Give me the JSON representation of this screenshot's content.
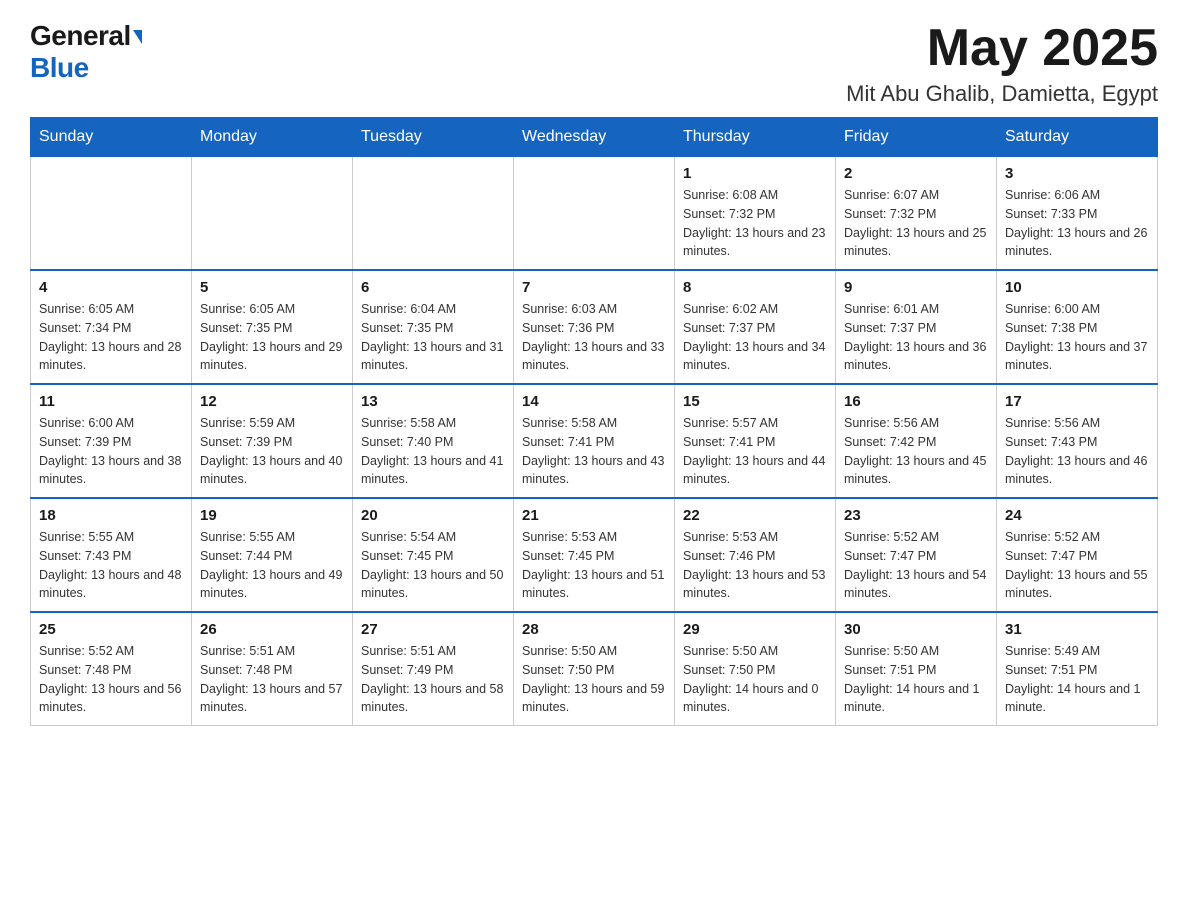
{
  "header": {
    "logo_general": "General",
    "logo_blue": "Blue",
    "month_title": "May 2025",
    "location": "Mit Abu Ghalib, Damietta, Egypt"
  },
  "weekdays": [
    "Sunday",
    "Monday",
    "Tuesday",
    "Wednesday",
    "Thursday",
    "Friday",
    "Saturday"
  ],
  "weeks": [
    [
      {
        "day": "",
        "sunrise": "",
        "sunset": "",
        "daylight": ""
      },
      {
        "day": "",
        "sunrise": "",
        "sunset": "",
        "daylight": ""
      },
      {
        "day": "",
        "sunrise": "",
        "sunset": "",
        "daylight": ""
      },
      {
        "day": "",
        "sunrise": "",
        "sunset": "",
        "daylight": ""
      },
      {
        "day": "1",
        "sunrise": "Sunrise: 6:08 AM",
        "sunset": "Sunset: 7:32 PM",
        "daylight": "Daylight: 13 hours and 23 minutes."
      },
      {
        "day": "2",
        "sunrise": "Sunrise: 6:07 AM",
        "sunset": "Sunset: 7:32 PM",
        "daylight": "Daylight: 13 hours and 25 minutes."
      },
      {
        "day": "3",
        "sunrise": "Sunrise: 6:06 AM",
        "sunset": "Sunset: 7:33 PM",
        "daylight": "Daylight: 13 hours and 26 minutes."
      }
    ],
    [
      {
        "day": "4",
        "sunrise": "Sunrise: 6:05 AM",
        "sunset": "Sunset: 7:34 PM",
        "daylight": "Daylight: 13 hours and 28 minutes."
      },
      {
        "day": "5",
        "sunrise": "Sunrise: 6:05 AM",
        "sunset": "Sunset: 7:35 PM",
        "daylight": "Daylight: 13 hours and 29 minutes."
      },
      {
        "day": "6",
        "sunrise": "Sunrise: 6:04 AM",
        "sunset": "Sunset: 7:35 PM",
        "daylight": "Daylight: 13 hours and 31 minutes."
      },
      {
        "day": "7",
        "sunrise": "Sunrise: 6:03 AM",
        "sunset": "Sunset: 7:36 PM",
        "daylight": "Daylight: 13 hours and 33 minutes."
      },
      {
        "day": "8",
        "sunrise": "Sunrise: 6:02 AM",
        "sunset": "Sunset: 7:37 PM",
        "daylight": "Daylight: 13 hours and 34 minutes."
      },
      {
        "day": "9",
        "sunrise": "Sunrise: 6:01 AM",
        "sunset": "Sunset: 7:37 PM",
        "daylight": "Daylight: 13 hours and 36 minutes."
      },
      {
        "day": "10",
        "sunrise": "Sunrise: 6:00 AM",
        "sunset": "Sunset: 7:38 PM",
        "daylight": "Daylight: 13 hours and 37 minutes."
      }
    ],
    [
      {
        "day": "11",
        "sunrise": "Sunrise: 6:00 AM",
        "sunset": "Sunset: 7:39 PM",
        "daylight": "Daylight: 13 hours and 38 minutes."
      },
      {
        "day": "12",
        "sunrise": "Sunrise: 5:59 AM",
        "sunset": "Sunset: 7:39 PM",
        "daylight": "Daylight: 13 hours and 40 minutes."
      },
      {
        "day": "13",
        "sunrise": "Sunrise: 5:58 AM",
        "sunset": "Sunset: 7:40 PM",
        "daylight": "Daylight: 13 hours and 41 minutes."
      },
      {
        "day": "14",
        "sunrise": "Sunrise: 5:58 AM",
        "sunset": "Sunset: 7:41 PM",
        "daylight": "Daylight: 13 hours and 43 minutes."
      },
      {
        "day": "15",
        "sunrise": "Sunrise: 5:57 AM",
        "sunset": "Sunset: 7:41 PM",
        "daylight": "Daylight: 13 hours and 44 minutes."
      },
      {
        "day": "16",
        "sunrise": "Sunrise: 5:56 AM",
        "sunset": "Sunset: 7:42 PM",
        "daylight": "Daylight: 13 hours and 45 minutes."
      },
      {
        "day": "17",
        "sunrise": "Sunrise: 5:56 AM",
        "sunset": "Sunset: 7:43 PM",
        "daylight": "Daylight: 13 hours and 46 minutes."
      }
    ],
    [
      {
        "day": "18",
        "sunrise": "Sunrise: 5:55 AM",
        "sunset": "Sunset: 7:43 PM",
        "daylight": "Daylight: 13 hours and 48 minutes."
      },
      {
        "day": "19",
        "sunrise": "Sunrise: 5:55 AM",
        "sunset": "Sunset: 7:44 PM",
        "daylight": "Daylight: 13 hours and 49 minutes."
      },
      {
        "day": "20",
        "sunrise": "Sunrise: 5:54 AM",
        "sunset": "Sunset: 7:45 PM",
        "daylight": "Daylight: 13 hours and 50 minutes."
      },
      {
        "day": "21",
        "sunrise": "Sunrise: 5:53 AM",
        "sunset": "Sunset: 7:45 PM",
        "daylight": "Daylight: 13 hours and 51 minutes."
      },
      {
        "day": "22",
        "sunrise": "Sunrise: 5:53 AM",
        "sunset": "Sunset: 7:46 PM",
        "daylight": "Daylight: 13 hours and 53 minutes."
      },
      {
        "day": "23",
        "sunrise": "Sunrise: 5:52 AM",
        "sunset": "Sunset: 7:47 PM",
        "daylight": "Daylight: 13 hours and 54 minutes."
      },
      {
        "day": "24",
        "sunrise": "Sunrise: 5:52 AM",
        "sunset": "Sunset: 7:47 PM",
        "daylight": "Daylight: 13 hours and 55 minutes."
      }
    ],
    [
      {
        "day": "25",
        "sunrise": "Sunrise: 5:52 AM",
        "sunset": "Sunset: 7:48 PM",
        "daylight": "Daylight: 13 hours and 56 minutes."
      },
      {
        "day": "26",
        "sunrise": "Sunrise: 5:51 AM",
        "sunset": "Sunset: 7:48 PM",
        "daylight": "Daylight: 13 hours and 57 minutes."
      },
      {
        "day": "27",
        "sunrise": "Sunrise: 5:51 AM",
        "sunset": "Sunset: 7:49 PM",
        "daylight": "Daylight: 13 hours and 58 minutes."
      },
      {
        "day": "28",
        "sunrise": "Sunrise: 5:50 AM",
        "sunset": "Sunset: 7:50 PM",
        "daylight": "Daylight: 13 hours and 59 minutes."
      },
      {
        "day": "29",
        "sunrise": "Sunrise: 5:50 AM",
        "sunset": "Sunset: 7:50 PM",
        "daylight": "Daylight: 14 hours and 0 minutes."
      },
      {
        "day": "30",
        "sunrise": "Sunrise: 5:50 AM",
        "sunset": "Sunset: 7:51 PM",
        "daylight": "Daylight: 14 hours and 1 minute."
      },
      {
        "day": "31",
        "sunrise": "Sunrise: 5:49 AM",
        "sunset": "Sunset: 7:51 PM",
        "daylight": "Daylight: 14 hours and 1 minute."
      }
    ]
  ]
}
